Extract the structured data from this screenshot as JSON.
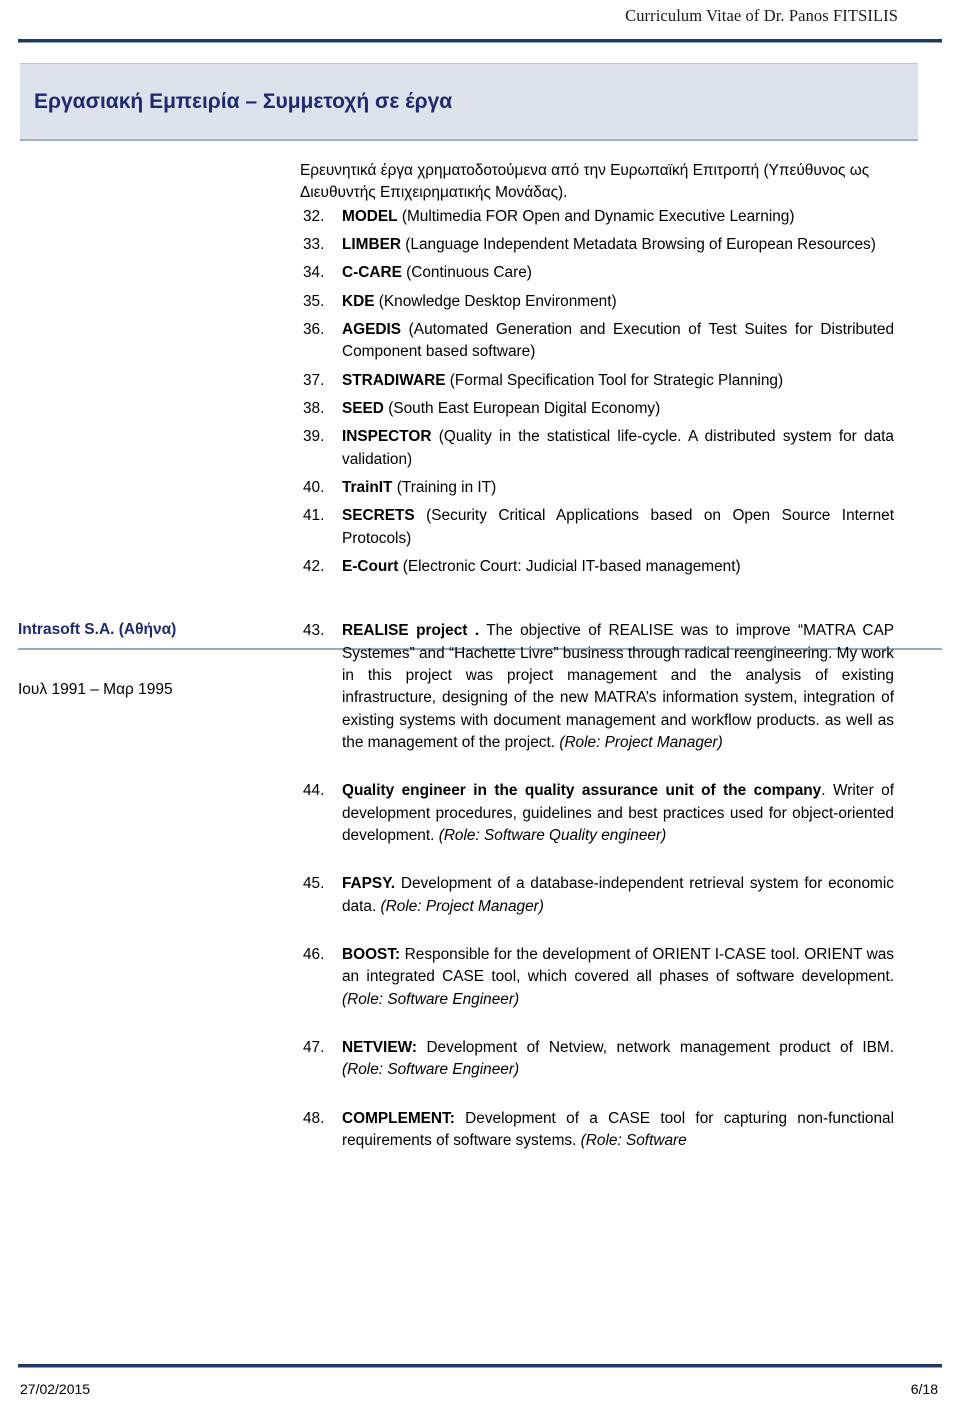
{
  "header": {
    "title": "Curriculum Vitae of Dr. Panos FITSILIS"
  },
  "section": {
    "title": "Εργασιακή Εμπειρία – Συμμετοχή σε έργα"
  },
  "block1": {
    "intro": "Ερευνητικά έργα χρηματοδοτούμενα από την Ευρωπαϊκή Επιτροπή (Υπεύθυνος ως Διευθυντής Επιχειρηματικής Μονάδας).",
    "items": [
      {
        "num": "32.",
        "lead": "MODEL",
        "rest": " (Multimedia FOR Open and Dynamic Executive Learning)"
      },
      {
        "num": "33.",
        "lead": "LIMBER",
        "rest": "  (Language Independent Metadata Browsing of European Resources)"
      },
      {
        "num": "34.",
        "lead": "C-CARE",
        "rest": "  (Continuous Care)"
      },
      {
        "num": "35.",
        "lead": "KDE",
        "rest": " (Knowledge Desktop Environment)"
      },
      {
        "num": "36.",
        "lead": "AGEDIS",
        "rest": " (Automated Generation and Execution of Test Suites for Distributed Component based software)"
      },
      {
        "num": "37.",
        "lead": "STRADIWARE",
        "rest": " (Formal Specification Tool for Strategic Planning)"
      },
      {
        "num": "38.",
        "lead": "SEED",
        "rest": " (South East European Digital Economy)"
      },
      {
        "num": "39.",
        "lead": "INSPECTOR",
        "rest": " (Quality in the statistical life-cycle. A distributed system for data validation)"
      },
      {
        "num": "40.",
        "lead": "TrainIT",
        "rest": " (Training in IT)"
      },
      {
        "num": "41.",
        "lead": "SECRETS",
        "rest": " (Security Critical Applications based on Open Source Internet Protocols)"
      },
      {
        "num": "42.",
        "lead": "E-Court",
        "rest": " (Electronic Court: Judicial IT-based management)"
      }
    ]
  },
  "block2": {
    "org": "Intrasoft S.A. (Αθήνα)",
    "dates": "Ιουλ 1991 – Μαρ 1995",
    "items": [
      {
        "num": "43.",
        "lead": "REALISE project .",
        "rest": " The objective of REALISE was to improve “MATRA CAP Systemes” and “Hachette Livre” business through radical reengineering. My work in this project was project management and the analysis of existing infrastructure, designing of the new MATRA’s information system, integration of existing systems with document management and workflow products. as well as the management of the project. ",
        "role": "(Role: Project Manager)"
      },
      {
        "num": "44.",
        "lead": "Quality engineer in the quality assurance unit of the company",
        "rest": ". Writer of development procedures, guidelines and best practices used for object-oriented development. ",
        "role": "(Role: Software Quality engineer)"
      },
      {
        "num": "45.",
        "lead": "FAPSY.",
        "rest": " Development of a database-independent retrieval system for economic data. ",
        "role": "(Role: Project Manager)"
      },
      {
        "num": "46.",
        "lead": "BOOST:",
        "rest": " Responsible for the development of ORIENT I-CASE tool. ORIENT was an integrated CASE tool, which covered all phases of software development. ",
        "role": "(Role: Software Engineer)"
      },
      {
        "num": "47.",
        "lead": "NETVIEW:",
        "rest": " Development of Netview, network management product of IBM. ",
        "role": "(Role: Software Engineer)"
      },
      {
        "num": "48.",
        "lead": "COMPLEMENT:",
        "rest": " Development of a CASE tool for capturing non-functional requirements of software systems. ",
        "role": "(Role: Software"
      }
    ]
  },
  "footer": {
    "date": "27/02/2015",
    "page": "6/18"
  },
  "colors": {
    "rule_navy": "#1f3864",
    "band_bg": "#dde3ec",
    "band_text": "#1f2a6e",
    "divider": "#9aa7c4"
  }
}
